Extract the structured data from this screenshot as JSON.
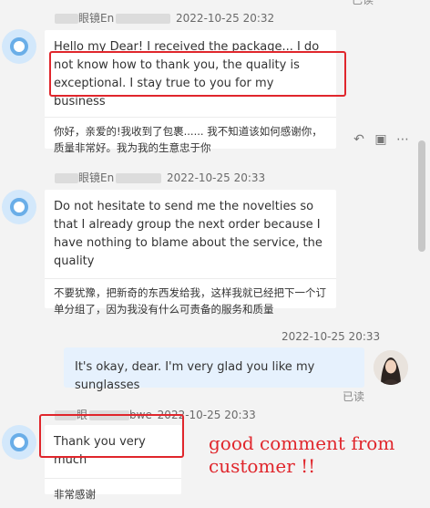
{
  "top_read_label": "已读",
  "messages": [
    {
      "sender_suffix": "眼镜En",
      "time": "2022-10-25 20:32",
      "text_en": "Hello my Dear! I received the package... I do not know how to thank you, the quality is exceptional. I stay true to you for my business",
      "text_zh": "你好，亲爱的!我收到了包裹...... 我不知道该如何感谢你，质量非常好。我为我的生意忠于你"
    },
    {
      "sender_suffix": "眼镜En",
      "time": "2022-10-25 20:33",
      "text_en": "Do not hesitate to send me the novelties so that I already group the next order because I have nothing to blame about the service, the quality",
      "text_zh": "不要犹豫，把新奇的东西发给我，这样我就已经把下一个订单分组了，因为我没有什么可责备的服务和质量"
    },
    {
      "sender_suffix": "眼",
      "sender_tail": "bwe",
      "time": "2022-10-25 20:33",
      "text_en": "Thank you very much",
      "text_zh": "非常感谢"
    }
  ],
  "my_message": {
    "time": "2022-10-25 20:33",
    "text": "It's okay, dear. I'm very glad you like my sunglasses",
    "read_label": "已读"
  },
  "annotation": "good comment from customer !!",
  "colors": {
    "highlight": "#e0262c",
    "my_bubble": "#e6f1fd",
    "avatar": "#6aaee8"
  }
}
